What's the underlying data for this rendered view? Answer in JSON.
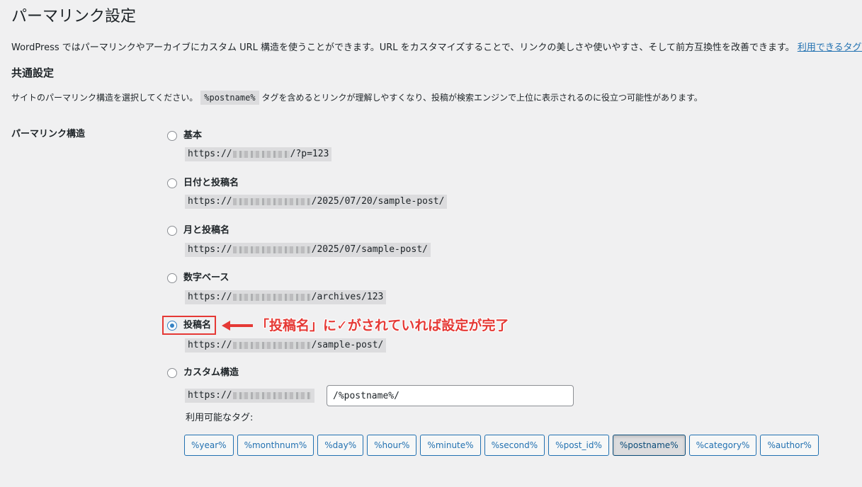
{
  "page": {
    "title": "パーマリンク設定",
    "intro": "WordPress ではパーマリンクやアーカイブにカスタム URL 構造を使うことができます。URL をカスタマイズすることで、リンクの美しさや使いやすさ、そして前方互換性を改善できます。",
    "intro_link": "利用できるタグは"
  },
  "common": {
    "title": "共通設定",
    "desc_before": "サイトのパーマリンク構造を選択してください。",
    "desc_code": "%postname%",
    "desc_after": "タグを含めるとリンクが理解しやすくなり、投稿が検索エンジンで上位に表示されるのに役立つ可能性があります。",
    "row_label": "パーマリンク構造"
  },
  "options": [
    {
      "label": "基本",
      "prefix": "https://",
      "suffix": "/?p=123",
      "checked": false
    },
    {
      "label": "日付と投稿名",
      "prefix": "https://",
      "suffix": "/2025/07/20/sample-post/",
      "checked": false
    },
    {
      "label": "月と投稿名",
      "prefix": "https://",
      "suffix": "/2025/07/sample-post/",
      "checked": false
    },
    {
      "label": "数字ベース",
      "prefix": "https://",
      "suffix": "/archives/123",
      "checked": false
    },
    {
      "label": "投稿名",
      "prefix": "https://",
      "suffix": "/sample-post/",
      "checked": true
    },
    {
      "label": "カスタム構造",
      "prefix": "https://",
      "checked": false
    }
  ],
  "custom": {
    "value": "/%postname%/",
    "tags_label": "利用可能なタグ:",
    "tags": [
      "%year%",
      "%monthnum%",
      "%day%",
      "%hour%",
      "%minute%",
      "%second%",
      "%post_id%",
      "%postname%",
      "%category%",
      "%author%"
    ],
    "active_tag": "%postname%"
  },
  "annotation": {
    "text": "「投稿名」に✓がされていれば設定が完了",
    "color": "#e53935"
  },
  "colors": {
    "accent": "#2271b1",
    "radio_checked": "#3582c4",
    "background": "#f0f0f1"
  }
}
